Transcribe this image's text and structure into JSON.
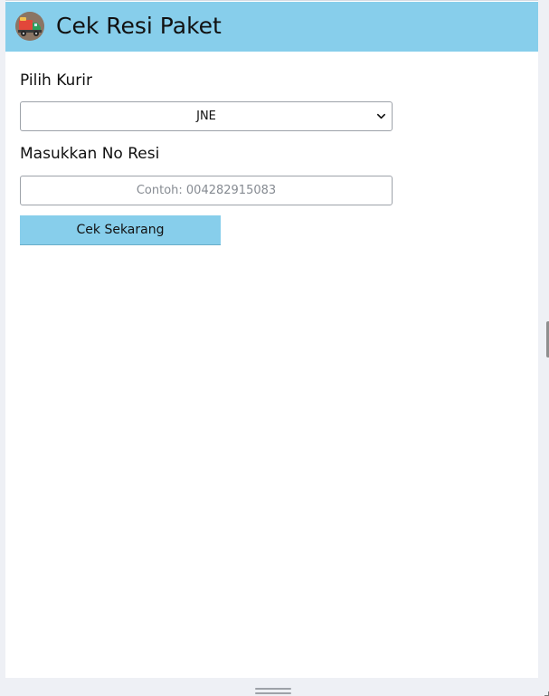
{
  "header": {
    "title": "Cek Resi Paket",
    "logo_icon": "delivery-truck-icon",
    "background_color": "#87ceeb"
  },
  "form": {
    "courier_label": "Pilih Kurir",
    "courier_selected": "JNE",
    "resi_label": "Masukkan No Resi",
    "resi_value": "",
    "resi_placeholder": "Contoh: 004282915083",
    "submit_label": "Cek Sekarang",
    "button_color": "#87ceeb"
  }
}
